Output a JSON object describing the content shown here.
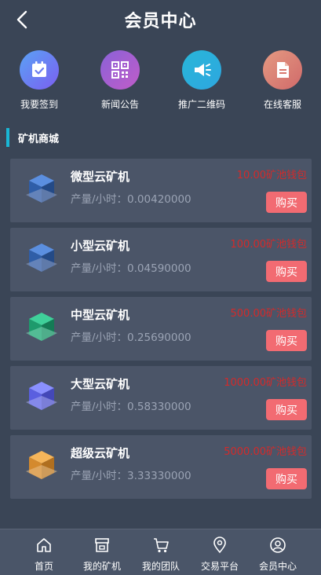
{
  "header": {
    "title": "会员中心"
  },
  "quick_actions": [
    {
      "label": "我要签到",
      "icon": "calendar-check-icon",
      "color": "#6b7df0"
    },
    {
      "label": "新闻公告",
      "icon": "qr-code-icon",
      "color": "#a25fd0"
    },
    {
      "label": "推广二维码",
      "icon": "megaphone-icon",
      "color": "#28b6d8"
    },
    {
      "label": "在线客服",
      "icon": "document-icon",
      "color": "#d8786e"
    }
  ],
  "section": {
    "title": "矿机商城"
  },
  "miners": [
    {
      "name": "微型云矿机",
      "rate": "产量/小时：0.00420000",
      "price": "10.00矿池钱包",
      "buy_label": "购买",
      "color": "#3d74c8"
    },
    {
      "name": "小型云矿机",
      "rate": "产量/小时：0.04590000",
      "price": "100.00矿池钱包",
      "buy_label": "购买",
      "color": "#3d74c8"
    },
    {
      "name": "中型云矿机",
      "rate": "产量/小时：0.25690000",
      "price": "500.00矿池钱包",
      "buy_label": "购买",
      "color": "#21a67a"
    },
    {
      "name": "大型云矿机",
      "rate": "产量/小时：0.58330000",
      "price": "1000.00矿池钱包",
      "buy_label": "购买",
      "color": "#6b6fe8"
    },
    {
      "name": "超级云矿机",
      "rate": "产量/小时：3.33330000",
      "price": "5000.00矿池钱包",
      "buy_label": "购买",
      "color": "#e39a3c"
    }
  ],
  "tabbar": [
    {
      "label": "首页",
      "icon": "home-icon"
    },
    {
      "label": "我的矿机",
      "icon": "store-icon"
    },
    {
      "label": "我的团队",
      "icon": "cart-icon"
    },
    {
      "label": "交易平台",
      "icon": "location-icon"
    },
    {
      "label": "会员中心",
      "icon": "user-icon"
    }
  ]
}
